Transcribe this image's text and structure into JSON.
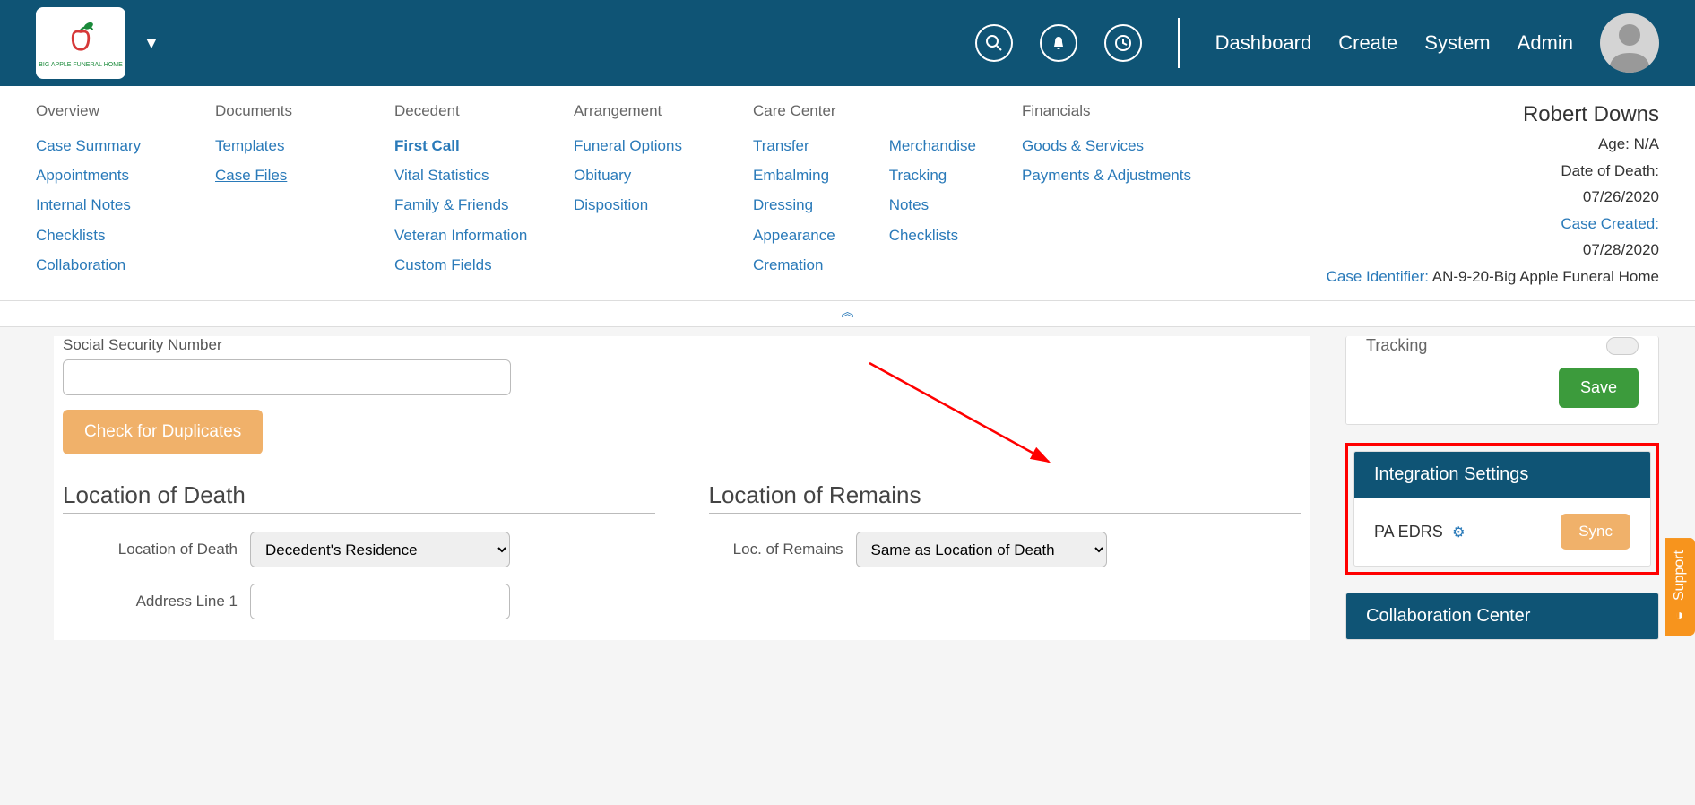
{
  "logo_text": "BIG APPLE FUNERAL HOME",
  "nav": {
    "dashboard": "Dashboard",
    "create": "Create",
    "system": "System",
    "admin": "Admin"
  },
  "subnav": {
    "overview": {
      "heading": "Overview",
      "links": [
        "Case Summary",
        "Appointments",
        "Internal Notes",
        "Checklists",
        "Collaboration"
      ]
    },
    "documents": {
      "heading": "Documents",
      "links": [
        "Templates",
        "Case Files"
      ]
    },
    "decedent": {
      "heading": "Decedent",
      "links": [
        "First Call",
        "Vital Statistics",
        "Family & Friends",
        "Veteran Information",
        "Custom Fields"
      ],
      "active_index": 0
    },
    "arrangement": {
      "heading": "Arrangement",
      "links": [
        "Funeral Options",
        "Obituary",
        "Disposition"
      ]
    },
    "care_center": {
      "heading": "Care Center",
      "col1": [
        "Transfer",
        "Embalming",
        "Dressing",
        "Appearance",
        "Cremation"
      ],
      "col2": [
        "Merchandise",
        "Tracking",
        "Notes",
        "Checklists"
      ]
    },
    "financials": {
      "heading": "Financials",
      "links": [
        "Goods & Services",
        "Payments & Adjustments"
      ]
    }
  },
  "case": {
    "name": "Robert Downs",
    "age_label": "Age:",
    "age_value": "N/A",
    "dod_label": "Date of Death:",
    "dod_value": "07/26/2020",
    "created_label": "Case Created:",
    "created_value": "07/28/2020",
    "id_label": "Case Identifier:",
    "id_value": "AN-9-20-Big Apple Funeral Home"
  },
  "form": {
    "ssn_label": "Social Security Number",
    "ssn_value": "",
    "check_duplicates": "Check for Duplicates",
    "location_of_death_heading": "Location of Death",
    "location_of_remains_heading": "Location of Remains",
    "location_of_death_label": "Location of Death",
    "location_of_death_value": "Decedent's Residence",
    "address1_label": "Address Line 1",
    "address1_value": "",
    "loc_remains_label": "Loc. of Remains",
    "loc_remains_value": "Same as Location of Death"
  },
  "side": {
    "tracking_label": "Tracking",
    "save": "Save",
    "integration_heading": "Integration Settings",
    "integration_name": "PA EDRS",
    "sync": "Sync",
    "collab_heading": "Collaboration Center"
  },
  "support_label": "Support"
}
